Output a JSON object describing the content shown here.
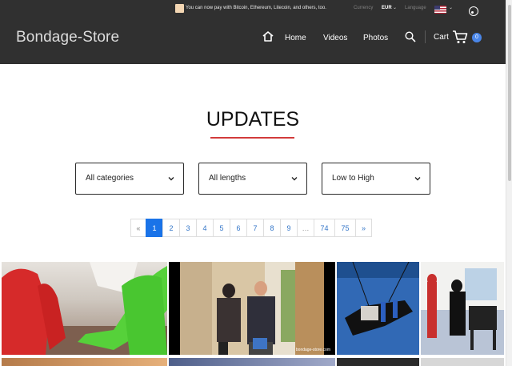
{
  "topbar": {
    "message": "You can now pay with Bitcoin, Ethereum, Litecoin, and others, too.",
    "currency_label": "Currency",
    "currency_value": "EUR",
    "language_label": "Language"
  },
  "header": {
    "logo": "Bondage-Store",
    "nav": [
      "Home",
      "Videos",
      "Photos"
    ],
    "cart_label": "Cart",
    "cart_count": "0"
  },
  "main": {
    "title": "UPDATES",
    "filters": [
      "All categories",
      "All lengths",
      "Low to High"
    ],
    "pagination": [
      "«",
      "1",
      "2",
      "3",
      "4",
      "5",
      "6",
      "7",
      "8",
      "9",
      "…",
      "74",
      "75",
      "»"
    ],
    "active_page": "1"
  },
  "thumbnails": {
    "watermark": "bondage-store.com"
  },
  "colors": {
    "header_bg": "#303030",
    "accent_blue": "#1a73e8",
    "title_underline": "#d23b3b",
    "cart_badge": "#4a86e8"
  }
}
